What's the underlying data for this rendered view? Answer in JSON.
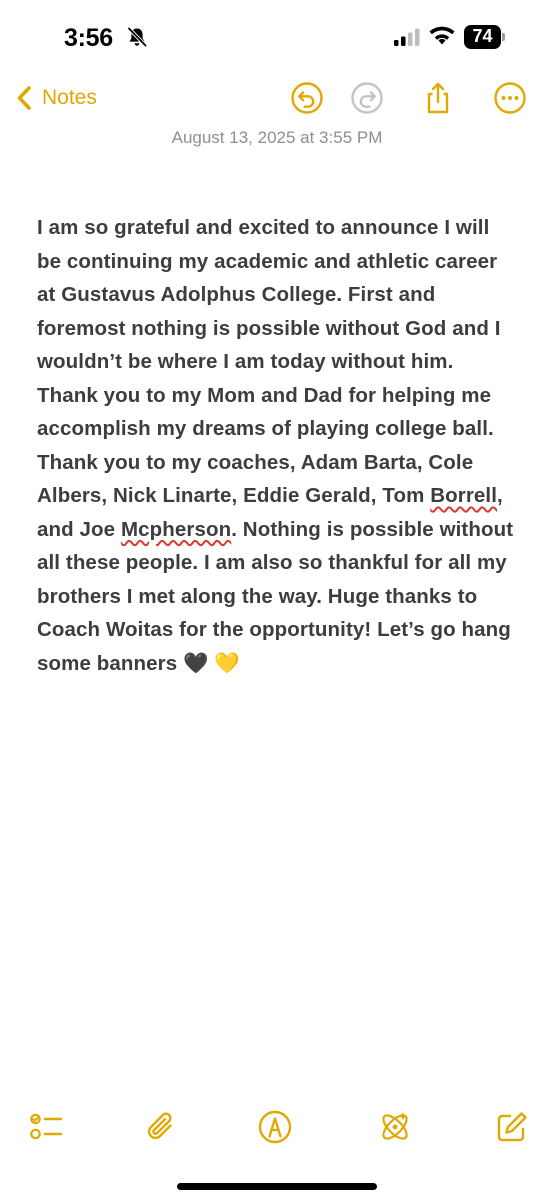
{
  "status_bar": {
    "time": "3:56",
    "battery": "74",
    "icons": [
      "bell-slash-icon",
      "cellular-signal-icon",
      "wifi-icon",
      "battery-icon"
    ]
  },
  "nav": {
    "back_label": "Notes",
    "accent_color": "#e0a800",
    "icons": [
      "chevron-left-icon",
      "undo-icon",
      "redo-icon",
      "share-icon",
      "more-icon"
    ]
  },
  "note": {
    "date": "August 13, 2025 at 3:55 PM",
    "body": {
      "p1": "I am so grateful and excited to announce I will be continuing my academic and athletic career at Gustavus Adolphus College. First and foremost nothing is possible without God and I wouldn’t be where I am today without him. Thank you to my Mom and Dad for helping me accomplish my dreams of playing college ball. Thank you to my coaches, Adam Barta, Cole Albers, Nick Linarte, Eddie Gerald, Tom ",
      "w1": "Borrell",
      "p2": ", and Joe ",
      "w2": "Mcpherson",
      "p3": ". Nothing is possible without all these people. I am also so thankful for all my brothers I met along the way. Huge thanks to Coach Woitas for the opportunity! Let’s go hang some banners 🖤 💛"
    }
  },
  "toolbar": {
    "icons": [
      "checklist-icon",
      "paperclip-icon",
      "markup-pen-icon",
      "writing-tools-icon",
      "compose-icon"
    ]
  }
}
